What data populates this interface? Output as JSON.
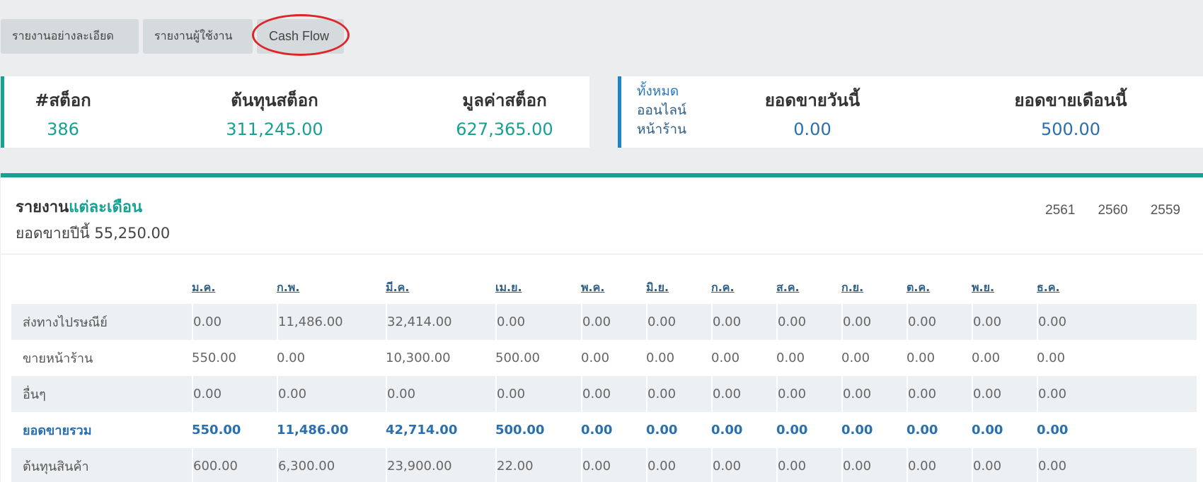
{
  "tabs": [
    "รายงานอย่างละเอียด",
    "รายงานผู้ใช้งาน",
    "Cash Flow"
  ],
  "stock_card": {
    "items": [
      {
        "label": "#สต็อก",
        "value": "386"
      },
      {
        "label": "ต้นทุนสต็อก",
        "value": "311,245.00"
      },
      {
        "label": "มูลค่าสต็อก",
        "value": "627,365.00"
      }
    ]
  },
  "sales_card": {
    "channels": [
      "ทั้งหมด",
      "ออนไลน์",
      "หน้าร้าน"
    ],
    "today_label": "ยอดขายวันนี้",
    "today_value": "0.00",
    "month_label": "ยอดขายเดือนนี้",
    "month_value": "500.00"
  },
  "report": {
    "title_prefix": "รายงาน",
    "title_highlight": "แต่ละเดือน",
    "subtitle": "ยอดขายปีนี้ 55,250.00",
    "years": [
      "2561",
      "2560",
      "2559"
    ],
    "months": [
      "ม.ค.",
      "ก.พ.",
      "มี.ค.",
      "เม.ย.",
      "พ.ค.",
      "มิ.ย.",
      "ก.ค.",
      "ส.ค.",
      "ก.ย.",
      "ต.ค.",
      "พ.ย.",
      "ธ.ค."
    ],
    "rows": [
      {
        "label": "ส่งทางไปรษณีย์",
        "values": [
          "0.00",
          "11,486.00",
          "32,414.00",
          "0.00",
          "0.00",
          "0.00",
          "0.00",
          "0.00",
          "0.00",
          "0.00",
          "0.00",
          "0.00"
        ]
      },
      {
        "label": "ขายหน้าร้าน",
        "values": [
          "550.00",
          "0.00",
          "10,300.00",
          "500.00",
          "0.00",
          "0.00",
          "0.00",
          "0.00",
          "0.00",
          "0.00",
          "0.00",
          "0.00"
        ]
      },
      {
        "label": "อื่นๆ",
        "values": [
          "0.00",
          "0.00",
          "0.00",
          "0.00",
          "0.00",
          "0.00",
          "0.00",
          "0.00",
          "0.00",
          "0.00",
          "0.00",
          "0.00"
        ]
      },
      {
        "label": "ยอดขายรวม",
        "values": [
          "550.00",
          "11,486.00",
          "42,714.00",
          "500.00",
          "0.00",
          "0.00",
          "0.00",
          "0.00",
          "0.00",
          "0.00",
          "0.00",
          "0.00"
        ]
      },
      {
        "label": "ต้นทุนสินค้า",
        "values": [
          "600.00",
          "6,300.00",
          "23,900.00",
          "22.00",
          "0.00",
          "0.00",
          "0.00",
          "0.00",
          "0.00",
          "0.00",
          "0.00",
          "0.00"
        ]
      }
    ]
  },
  "colors": {
    "teal": "#16a193",
    "blue": "#2a6faf",
    "highlight_circle": "#e0252a"
  }
}
